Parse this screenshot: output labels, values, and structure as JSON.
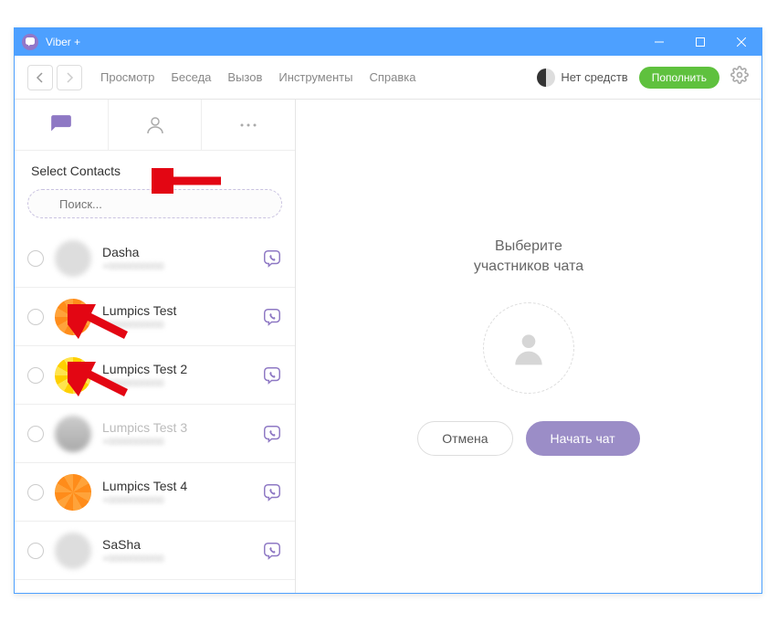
{
  "window": {
    "title": "Viber +"
  },
  "menu": {
    "items": [
      "Просмотр",
      "Беседа",
      "Вызов",
      "Инструменты",
      "Справка"
    ],
    "balance_label": "Нет средств",
    "topup_label": "Пополнить"
  },
  "left": {
    "select_header": "Select Contacts",
    "search_placeholder": "Поиск...",
    "contacts": [
      {
        "name": "Dasha",
        "avatar": "blur",
        "dim": false
      },
      {
        "name": "Lumpics Test",
        "avatar": "orange",
        "dim": false
      },
      {
        "name": "Lumpics Test 2",
        "avatar": "lemon",
        "dim": false
      },
      {
        "name": "Lumpics Test 3",
        "avatar": "person",
        "dim": true
      },
      {
        "name": "Lumpics Test 4",
        "avatar": "orange",
        "dim": false
      },
      {
        "name": "SaSha",
        "avatar": "blur",
        "dim": false
      }
    ]
  },
  "right": {
    "title_line1": "Выберите",
    "title_line2": "участников чата",
    "cancel_label": "Отмена",
    "start_label": "Начать чат"
  }
}
